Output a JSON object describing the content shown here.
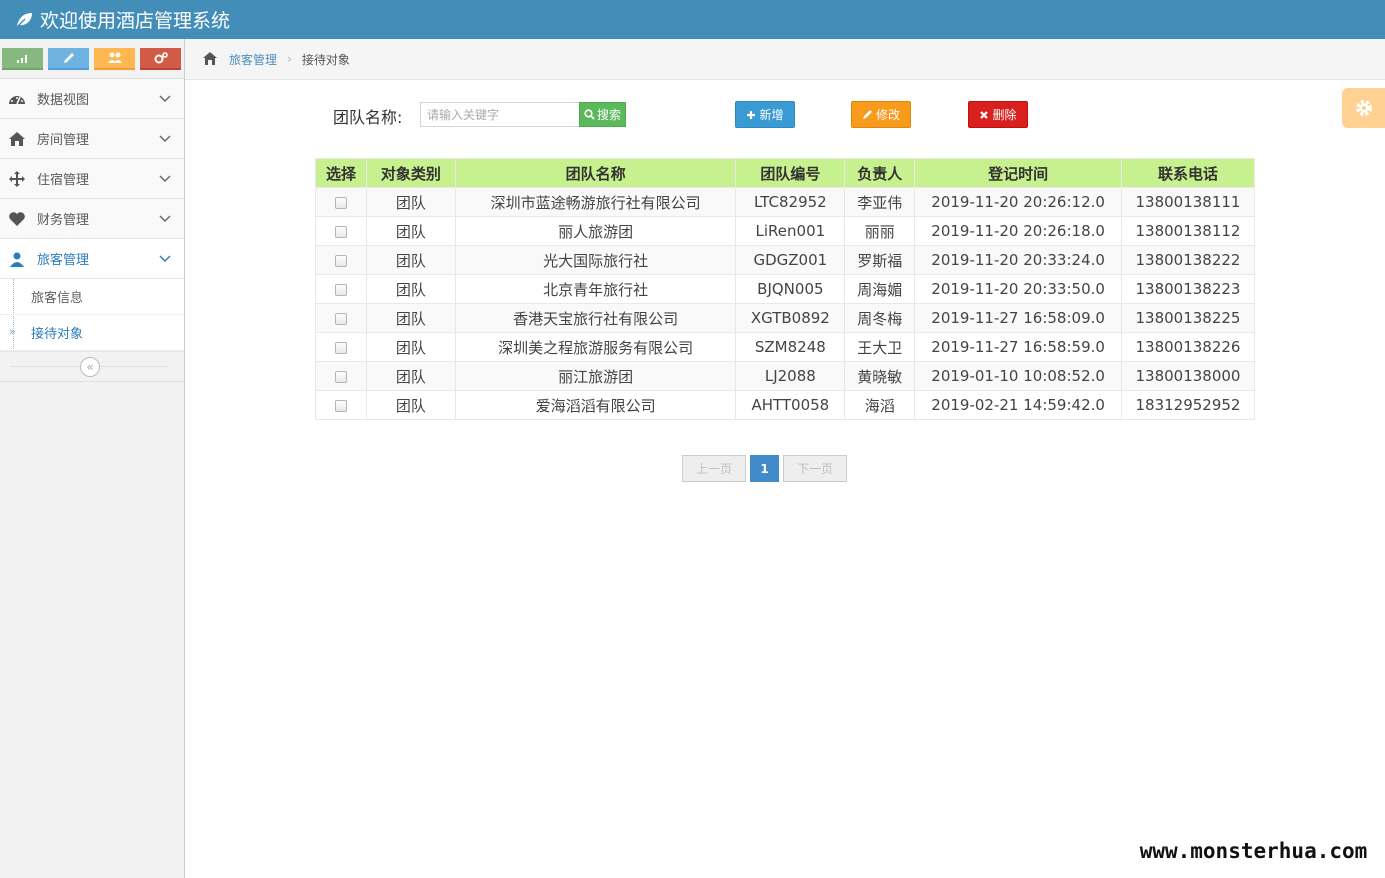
{
  "app": {
    "title": "欢迎使用酒店管理系统"
  },
  "shortcuts": [
    {
      "icon": "signal-icon",
      "color": "#87b87f"
    },
    {
      "icon": "pencil-icon",
      "color": "#6fb3e0"
    },
    {
      "icon": "users-icon",
      "color": "#ffb752"
    },
    {
      "icon": "cogs-icon",
      "color": "#d15b47"
    }
  ],
  "sidebar": {
    "items": [
      {
        "label": "数据视图",
        "icon": "dashboard-icon"
      },
      {
        "label": "房间管理",
        "icon": "home-icon"
      },
      {
        "label": "住宿管理",
        "icon": "move-icon"
      },
      {
        "label": "财务管理",
        "icon": "heart-icon"
      },
      {
        "label": "旅客管理",
        "icon": "user-icon"
      }
    ],
    "subitems": [
      {
        "label": "旅客信息"
      },
      {
        "label": "接待对象"
      }
    ],
    "collapse_glyph": "«"
  },
  "breadcrumb": {
    "parent": "旅客管理",
    "separator": "›",
    "current": "接待对象"
  },
  "search": {
    "label": "团队名称:",
    "placeholder": "请输入关键字",
    "button": "搜索"
  },
  "actions": {
    "add": "新增",
    "edit": "修改",
    "delete": "删除"
  },
  "table": {
    "headers": [
      "选择",
      "对象类别",
      "团队名称",
      "团队编号",
      "负责人",
      "登记时间",
      "联系电话"
    ],
    "rows": [
      [
        "团队",
        "深圳市蓝途畅游旅行社有限公司",
        "LTC82952",
        "李亚伟",
        "2019-11-20 20:26:12.0",
        "13800138111"
      ],
      [
        "团队",
        "丽人旅游团",
        "LiRen001",
        "丽丽",
        "2019-11-20 20:26:18.0",
        "13800138112"
      ],
      [
        "团队",
        "光大国际旅行社",
        "GDGZ001",
        "罗斯福",
        "2019-11-20 20:33:24.0",
        "13800138222"
      ],
      [
        "团队",
        "北京青年旅行社",
        "BJQN005",
        "周海媚",
        "2019-11-20 20:33:50.0",
        "13800138223"
      ],
      [
        "团队",
        "香港天宝旅行社有限公司",
        "XGTB0892",
        "周冬梅",
        "2019-11-27 16:58:09.0",
        "13800138225"
      ],
      [
        "团队",
        "深圳美之程旅游服务有限公司",
        "SZM8248",
        "王大卫",
        "2019-11-27 16:58:59.0",
        "13800138226"
      ],
      [
        "团队",
        "丽江旅游团",
        "LJ2088",
        "黄晓敏",
        "2019-01-10 10:08:52.0",
        "13800138000"
      ],
      [
        "团队",
        "爱海滔滔有限公司",
        "AHTT0058",
        "海滔",
        "2019-02-21 14:59:42.0",
        "18312952952"
      ]
    ]
  },
  "pagination": {
    "prev": "上一页",
    "current": "1",
    "next": "下一页"
  },
  "watermark": "www.monsterhua.com",
  "colors": {
    "topbar": "#438eb9",
    "table_header": "#c7f08f",
    "add": "#3a9bd4",
    "edit": "#f89a1a",
    "delete": "#d9201e",
    "search": "#5cb85c"
  }
}
